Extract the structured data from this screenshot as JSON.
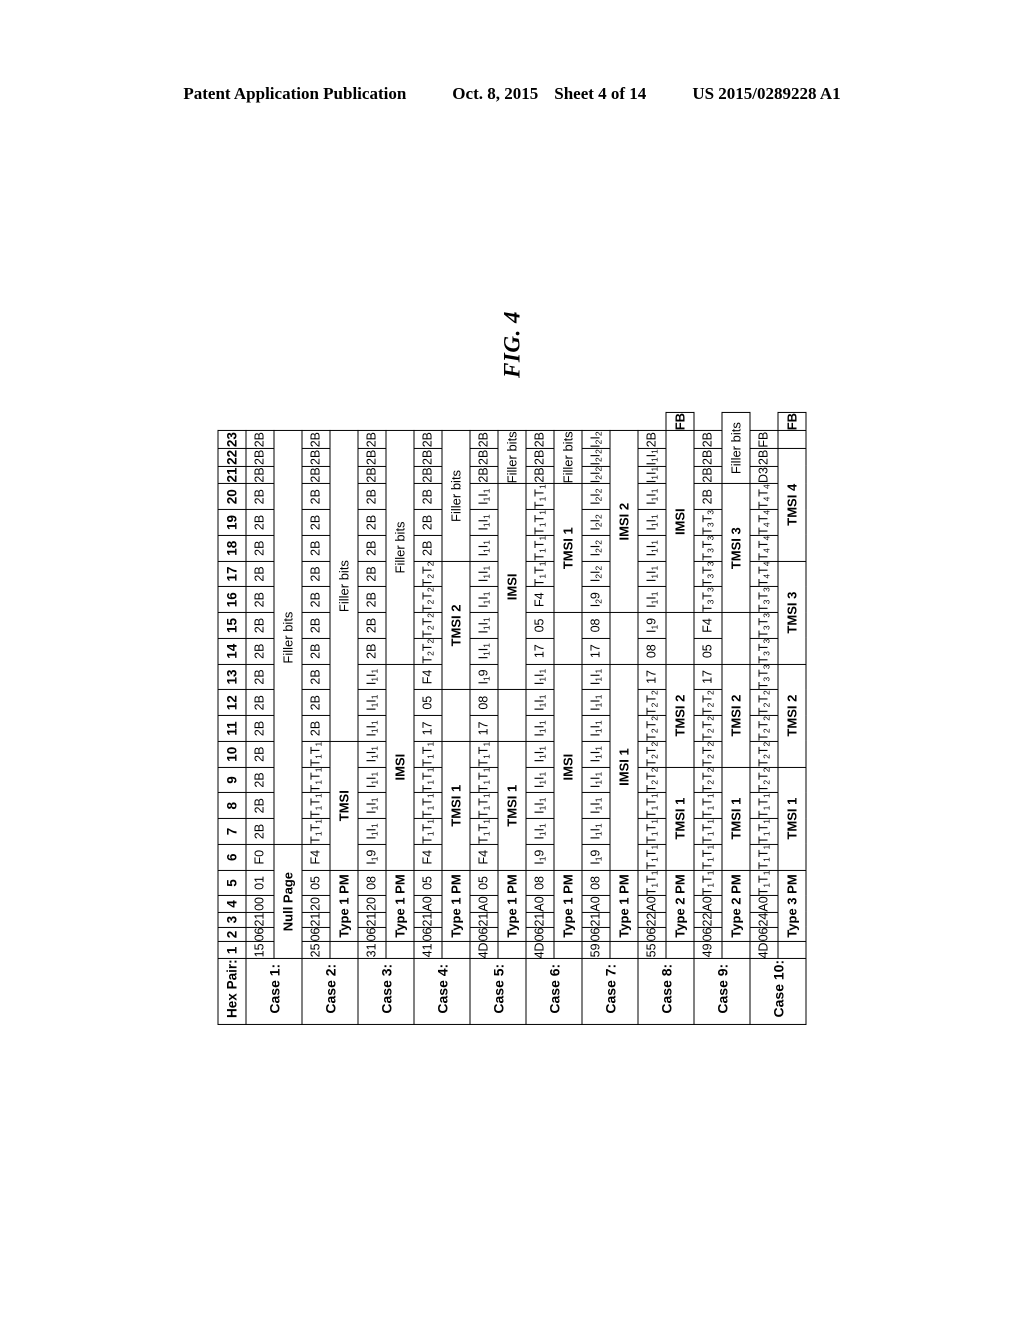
{
  "header": {
    "publication": "Patent Application Publication",
    "date": "Oct. 8, 2015",
    "sheet": "Sheet 4 of 14",
    "patent_number": "US 2015/0289228 A1"
  },
  "figure": {
    "caption": "FIG. 4",
    "row_header_label": "Hex Pair:",
    "columns": [
      "1",
      "2",
      "3",
      "4",
      "5",
      "6",
      "7",
      "8",
      "9",
      "10",
      "11",
      "12",
      "13",
      "14",
      "15",
      "16",
      "17",
      "18",
      "19",
      "20",
      "21",
      "22",
      "23"
    ],
    "cases": [
      {
        "label": "Case 1:",
        "values": [
          "15",
          "06",
          "21",
          "00",
          "01",
          "F0",
          "2B",
          "2B",
          "2B",
          "2B",
          "2B",
          "2B",
          "2B",
          "2B",
          "2B",
          "2B",
          "2B",
          "2B",
          "2B",
          "2B",
          "2B",
          "2B",
          "2B"
        ],
        "notes": [
          {
            "text": "Null Page",
            "start": 1,
            "span": 6
          },
          {
            "text": "Filler bits",
            "start": 7,
            "span": 17,
            "light": true
          }
        ]
      },
      {
        "label": "Case 2:",
        "values": [
          "25",
          "06",
          "21",
          "20",
          "05",
          "F4",
          "T₁T₁",
          "T₁T₁",
          "T₁T₁",
          "T₁T₁",
          "2B",
          "2B",
          "2B",
          "2B",
          "2B",
          "2B",
          "2B",
          "2B",
          "2B",
          "2B",
          "2B",
          "2B",
          "2B"
        ],
        "notes": [
          {
            "text": "Type 1 PM",
            "start": 2,
            "span": 4
          },
          {
            "text": "TMSI",
            "start": 6,
            "span": 5
          },
          {
            "text": "Filler bits",
            "start": 11,
            "span": 13,
            "light": true
          }
        ]
      },
      {
        "label": "Case 3:",
        "values": [
          "31",
          "06",
          "21",
          "20",
          "08",
          "I₁9",
          "I₁I₁",
          "I₁I₁",
          "I₁I₁",
          "I₁I₁",
          "I₁I₁",
          "I₁I₁",
          "I₁I₁",
          "2B",
          "2B",
          "2B",
          "2B",
          "2B",
          "2B",
          "2B",
          "2B",
          "2B",
          "2B"
        ],
        "notes": [
          {
            "text": "Type 1 PM",
            "start": 2,
            "span": 4
          },
          {
            "text": "IMSI",
            "start": 6,
            "span": 8
          },
          {
            "text": "Filler bits",
            "start": 14,
            "span": 10,
            "light": true
          }
        ]
      },
      {
        "label": "Case 4:",
        "values": [
          "41",
          "06",
          "21",
          "A0",
          "05",
          "F4",
          "T₁T₁",
          "T₁T₁",
          "T₁T₁",
          "T₁T₁",
          "17",
          "05",
          "F4",
          "T₂T₂",
          "T₂T₂",
          "T₂T₂",
          "T₂T₂",
          "2B",
          "2B",
          "2B",
          "2B",
          "2B",
          "2B"
        ],
        "notes": [
          {
            "text": "Type 1 PM",
            "start": 2,
            "span": 4
          },
          {
            "text": "TMSI 1",
            "start": 6,
            "span": 5
          },
          {
            "text": "TMSI 2",
            "start": 13,
            "span": 5
          },
          {
            "text": "Filler bits",
            "start": 18,
            "span": 6,
            "light": true
          }
        ]
      },
      {
        "label": "Case 5:",
        "values": [
          "4D",
          "06",
          "21",
          "A0",
          "05",
          "F4",
          "T₁T₁",
          "T₁T₁",
          "T₁T₁",
          "T₁T₁",
          "17",
          "08",
          "I₁9",
          "I₁I₁",
          "I₁I₁",
          "I₁I₁",
          "I₁I₁",
          "I₁I₁",
          "I₁I₁",
          "I₁I₁",
          "2B",
          "2B",
          "2B"
        ],
        "notes": [
          {
            "text": "Type 1 PM",
            "start": 2,
            "span": 4
          },
          {
            "text": "TMSI 1",
            "start": 6,
            "span": 5
          },
          {
            "text": "IMSI",
            "start": 13,
            "span": 8
          },
          {
            "text": "Filler bits",
            "start": 21,
            "span": 3,
            "light": true
          }
        ]
      },
      {
        "label": "Case 6:",
        "values": [
          "4D",
          "06",
          "21",
          "A0",
          "08",
          "I₁9",
          "I₁I₁",
          "I₁I₁",
          "I₁I₁",
          "I₁I₁",
          "I₁I₁",
          "I₁I₁",
          "I₁I₁",
          "17",
          "05",
          "F4",
          "T₁T₁",
          "T₁T₁",
          "T₁T₁",
          "T₁T₁",
          "2B",
          "2B",
          "2B"
        ],
        "notes": [
          {
            "text": "Type 1 PM",
            "start": 2,
            "span": 4
          },
          {
            "text": "IMSI",
            "start": 6,
            "span": 8
          },
          {
            "text": "TMSI 1",
            "start": 16,
            "span": 5
          },
          {
            "text": "Filler bits",
            "start": 21,
            "span": 3,
            "light": true
          }
        ]
      },
      {
        "label": "Case 7:",
        "values": [
          "59",
          "06",
          "21",
          "A0",
          "08",
          "I₁9",
          "I₁I₁",
          "I₁I₁",
          "I₁I₁",
          "I₁I₁",
          "I₁I₁",
          "I₁I₁",
          "I₁I₁",
          "17",
          "08",
          "I₂9",
          "I₂I₂",
          "I₂I₂",
          "I₂I₂",
          "I₂I₂",
          "I₂I₂",
          "I₂I₂",
          "I₂I₂"
        ],
        "notes": [
          {
            "text": "Type 1 PM",
            "start": 2,
            "span": 4
          },
          {
            "text": "IMSI 1",
            "start": 6,
            "span": 8
          },
          {
            "text": "IMSI 2",
            "start": 16,
            "span": 8
          }
        ]
      },
      {
        "label": "Case 8:",
        "values": [
          "55",
          "06",
          "22",
          "A0",
          "T₁T₁",
          "T₁T₁",
          "T₁T₁",
          "T₁T₁",
          "T₂T₂",
          "T₂T₂",
          "T₂T₂",
          "T₂T₂",
          "17",
          "08",
          "I₁9",
          "I₁I₁",
          "I₁I₁",
          "I₁I₁",
          "I₁I₁",
          "I₁I₁",
          "I₁I₁",
          "I₁I₁",
          "2B"
        ],
        "notes": [
          {
            "text": "Type 2 PM",
            "start": 2,
            "span": 4
          },
          {
            "text": "TMSI 1",
            "start": 5,
            "span": 4
          },
          {
            "text": "TMSI 2",
            "start": 9,
            "span": 4
          },
          {
            "text": "IMSI",
            "start": 15,
            "span": 8
          },
          {
            "text": "FB",
            "start": 23,
            "span": 1
          }
        ]
      },
      {
        "label": "Case 9:",
        "values": [
          "49",
          "06",
          "22",
          "A0",
          "T₁T₁",
          "T₁T₁",
          "T₁T₁",
          "T₁T₁",
          "T₂T₂",
          "T₂T₂",
          "T₂T₂",
          "T₂T₂",
          "17",
          "05",
          "F4",
          "T₃T₃",
          "T₃T₃",
          "T₃T₃",
          "T₃T₃",
          "2B",
          "2B",
          "2B",
          "2B"
        ],
        "notes": [
          {
            "text": "Type 2 PM",
            "start": 2,
            "span": 4
          },
          {
            "text": "TMSI 1",
            "start": 5,
            "span": 4
          },
          {
            "text": "TMSI 2",
            "start": 9,
            "span": 4
          },
          {
            "text": "TMSI 3",
            "start": 15,
            "span": 5
          },
          {
            "text": "Filler bits",
            "start": 20,
            "span": 4,
            "light": true
          }
        ]
      },
      {
        "label": "Case 10:",
        "values": [
          "4D",
          "06",
          "24",
          "A0",
          "T₁T₁",
          "T₁T₁",
          "T₁T₁",
          "T₁T₁",
          "T₂T₂",
          "T₂T₂",
          "T₂T₂",
          "T₂T₂",
          "T₃T₃",
          "T₃T₃",
          "T₃T₃",
          "T₃T₃",
          "T₄T₄",
          "T₄T₄",
          "T₄T₄",
          "T₄T₄",
          "D3",
          "2B",
          "FB"
        ],
        "notes": [
          {
            "text": "Type 3 PM",
            "start": 2,
            "span": 4
          },
          {
            "text": "TMSI 1",
            "start": 5,
            "span": 4
          },
          {
            "text": "TMSI 2",
            "start": 9,
            "span": 4
          },
          {
            "text": "TMSI 3",
            "start": 13,
            "span": 4
          },
          {
            "text": "TMSI 4",
            "start": 17,
            "span": 5
          },
          {
            "text": "FB",
            "start": 23,
            "span": 1
          }
        ]
      }
    ]
  }
}
